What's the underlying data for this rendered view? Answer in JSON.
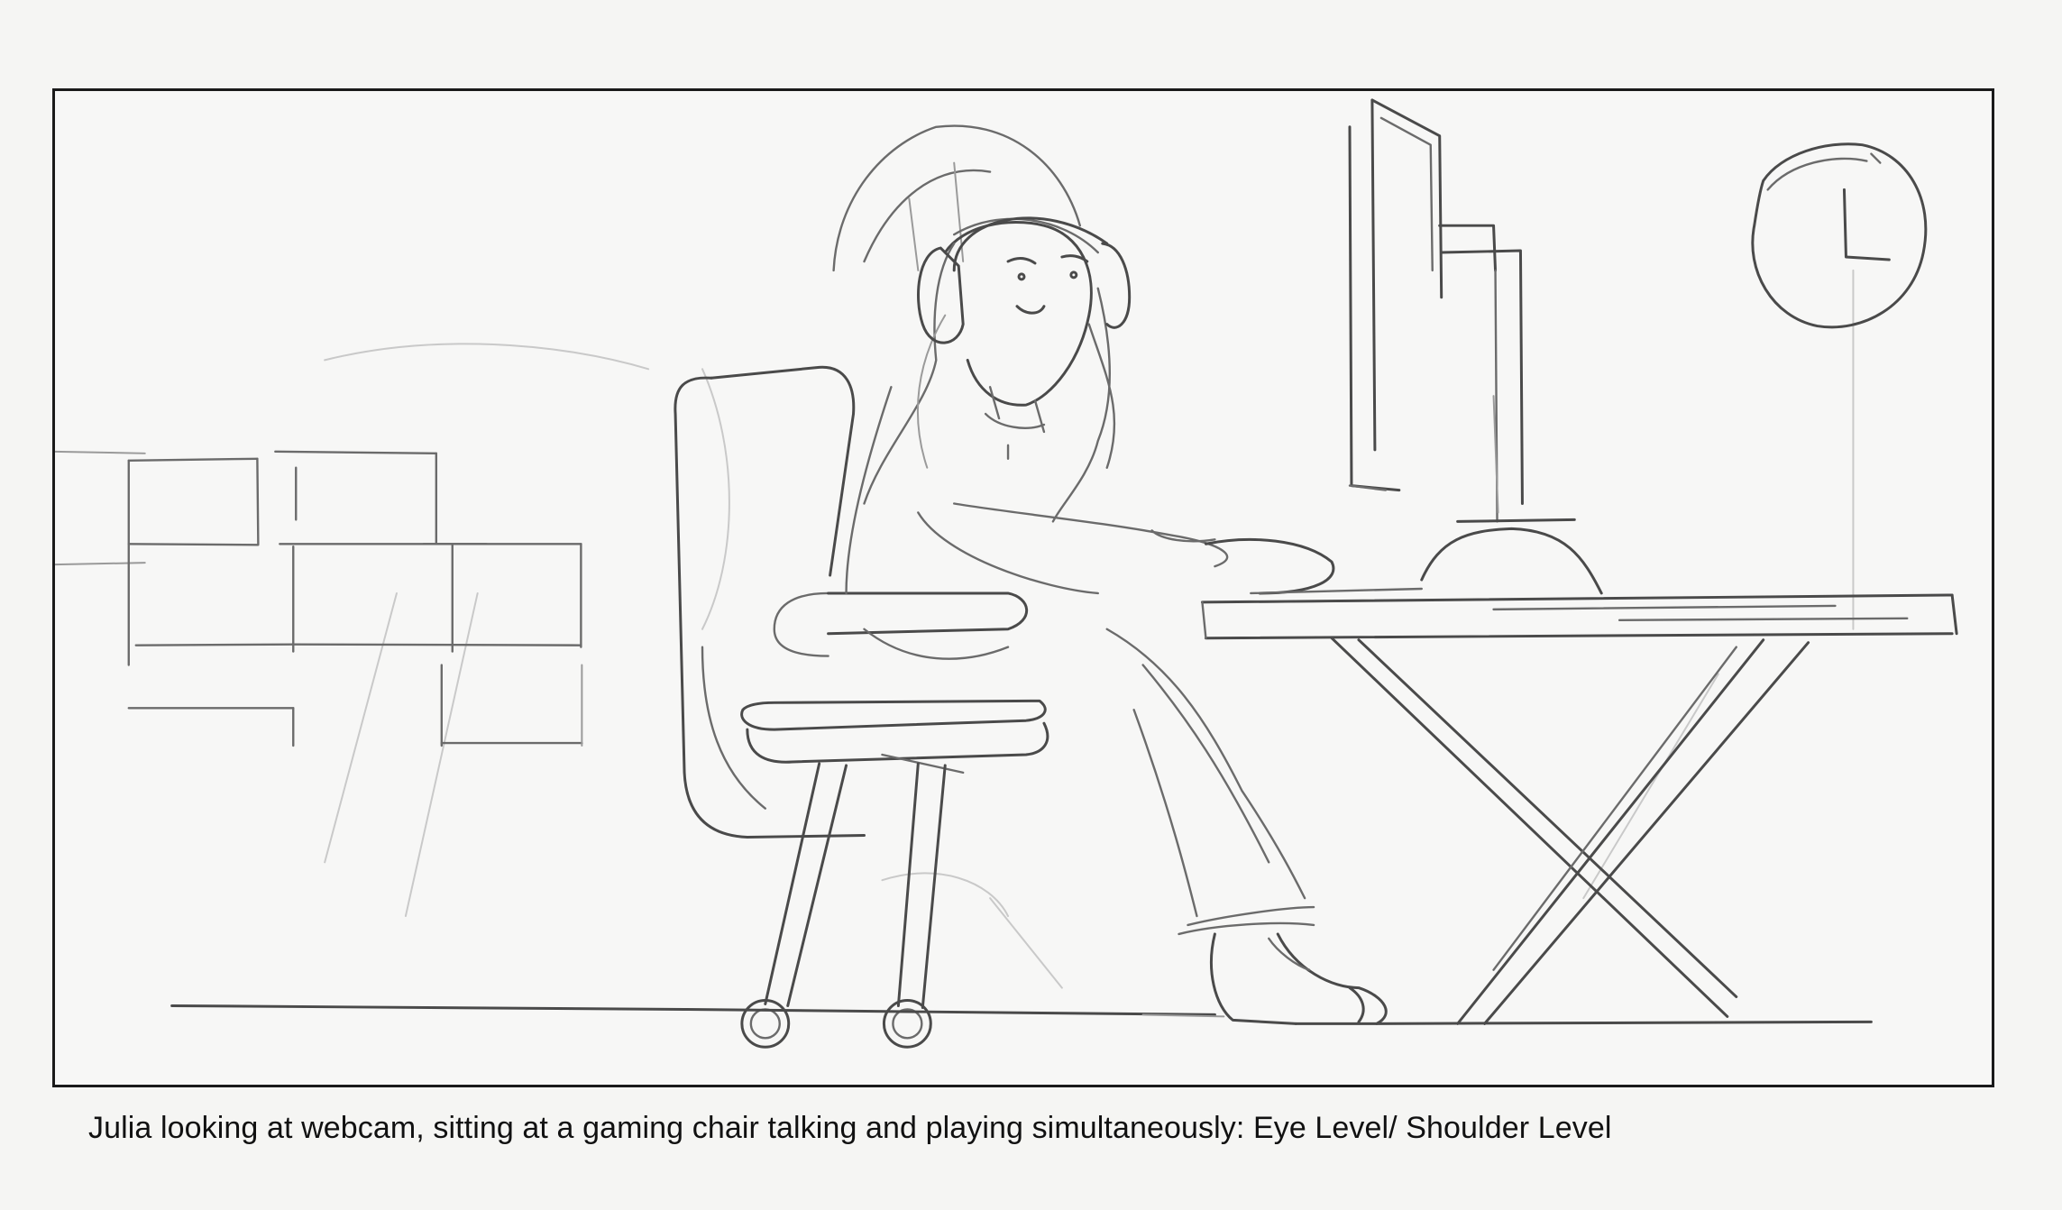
{
  "storyboard": {
    "caption": "Julia looking at webcam, sitting at a gaming chair talking and playing simultaneously: Eye Level/ Shoulder Level"
  },
  "sketch": {
    "medium": "pencil",
    "elements": [
      "background-window-panes",
      "gaming-chair",
      "julia-figure",
      "headset",
      "computer-monitor",
      "desk",
      "wall-clock",
      "floor-line"
    ]
  }
}
